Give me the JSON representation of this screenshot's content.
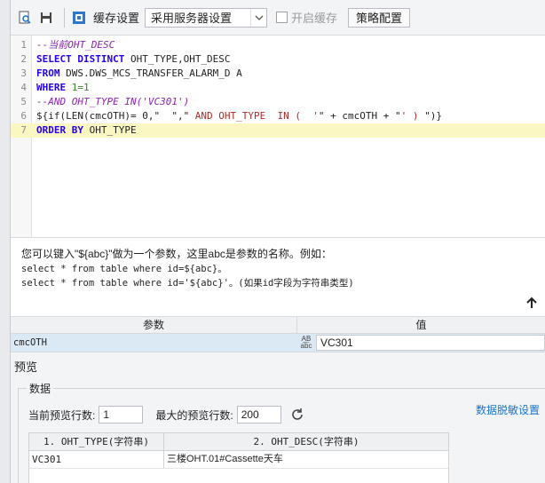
{
  "toolbar": {
    "cache_label": "缓存设置",
    "cache_option": "采用服务器设置",
    "enable_cache_label": "开启缓存",
    "strategy_button": "策略配置"
  },
  "editor": {
    "lines": [
      {
        "n": "1",
        "tokens": [
          {
            "t": "--当前OHT_DESC",
            "c": "comment"
          }
        ]
      },
      {
        "n": "2",
        "tokens": [
          {
            "t": "SELECT DISTINCT",
            "c": "kw"
          },
          {
            "t": " OHT_TYPE,OHT_DESC",
            "c": "plain"
          }
        ]
      },
      {
        "n": "3",
        "tokens": [
          {
            "t": "FROM",
            "c": "kw"
          },
          {
            "t": " DWS.DWS_MCS_TRANSFER_ALARM_D A",
            "c": "plain"
          }
        ]
      },
      {
        "n": "4",
        "tokens": [
          {
            "t": "WHERE",
            "c": "kw"
          },
          {
            "t": " 1=1",
            "c": "num"
          }
        ]
      },
      {
        "n": "5",
        "tokens": [
          {
            "t": "--AND OHT_TYPE IN('VC301')",
            "c": "comment"
          }
        ]
      },
      {
        "n": "6",
        "tokens": [
          {
            "t": "${if(LEN(cmcOTH)= 0,\"  \",\"",
            "c": "plain"
          },
          {
            "t": " AND OHT_TYPE  IN (  '",
            "c": "str"
          },
          {
            "t": "\" + cmcOTH + \"",
            "c": "plain"
          },
          {
            "t": "' ) ",
            "c": "str"
          },
          {
            "t": "\")}",
            "c": "plain"
          }
        ]
      },
      {
        "n": "7",
        "tokens": [
          {
            "t": "ORDER BY",
            "c": "kw"
          },
          {
            "t": " OHT_TYPE",
            "c": "plain"
          }
        ]
      }
    ]
  },
  "hint": {
    "line1": "您可以键入\"${abc}\"做为一个参数，这里abc是参数的名称。例如：",
    "line2": "select * from table where id=${abc}。",
    "line3": "select * from table where id='${abc}'。(如果id字段为字符串类型)"
  },
  "params": {
    "header_param": "参数",
    "header_value": "值",
    "rows": [
      {
        "name": "cmcOTH",
        "value": "VC301"
      }
    ]
  },
  "preview": {
    "title": "预览",
    "group_label": "数据",
    "current_rows_label": "当前预览行数:",
    "current_rows_value": "1",
    "max_rows_label": "最大的预览行数:",
    "max_rows_value": "200",
    "desensitize_link": "数据脱敏设置",
    "columns": [
      "1. OHT_TYPE(字符串)",
      "2. OHT_DESC(字符串)"
    ],
    "rows": [
      [
        "VC301",
        "三楼OHT.01#Cassette天车"
      ]
    ]
  }
}
